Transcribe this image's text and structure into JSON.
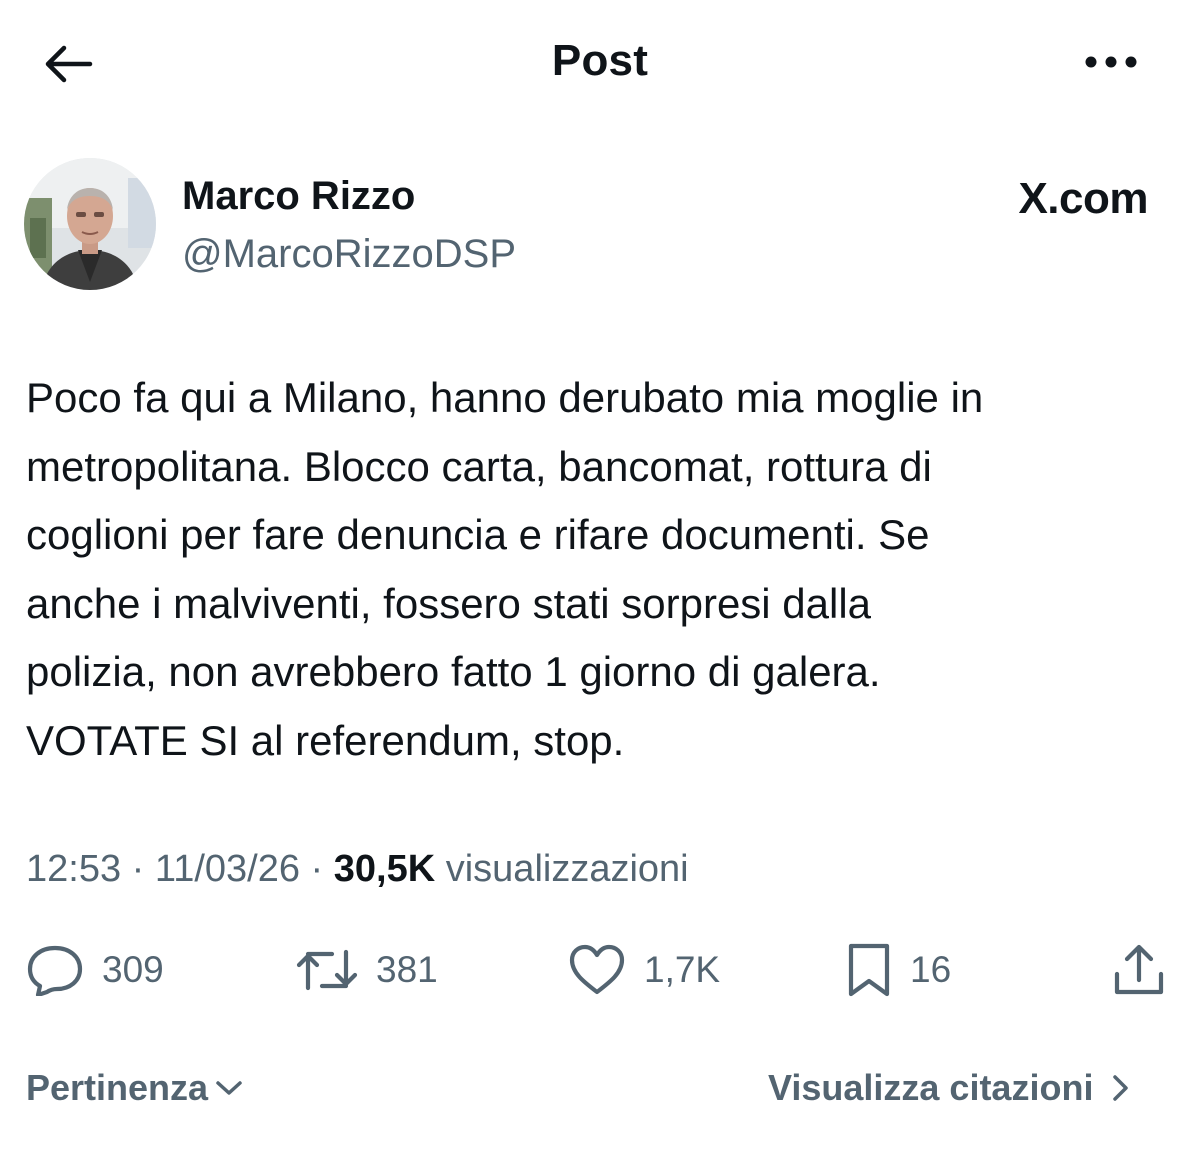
{
  "header": {
    "title": "Post",
    "back_icon": "arrow-left-icon",
    "more_icon": "more-horizontal-icon"
  },
  "author": {
    "name": "Marco Rizzo",
    "handle": "@MarcoRizzoDSP"
  },
  "brand": "X.com",
  "tweet": {
    "lines": [
      "Poco fa qui a Milano, hanno derubato mia moglie in",
      "metropolitana. Blocco carta, bancomat, rottura di",
      "coglioni per fare denuncia e rifare documenti. Se",
      "anche i malviventi, fossero stati sorpresi dalla",
      "polizia, non avrebbero fatto 1 giorno di galera.",
      "VOTATE SI al referendum, stop."
    ]
  },
  "meta": {
    "time": "12:53",
    "separator": "·",
    "date": "11/03/26",
    "views_count": "30,5K",
    "views_label": "visualizzazioni"
  },
  "actions": {
    "replies": "309",
    "reposts": "381",
    "likes": "1,7K",
    "bookmarks": "16"
  },
  "footer": {
    "sort_label": "Pertinenza",
    "quotes_label": "Visualizza citazioni"
  },
  "colors": {
    "text": "#0f1419",
    "secondary": "#536471",
    "background": "#ffffff"
  }
}
